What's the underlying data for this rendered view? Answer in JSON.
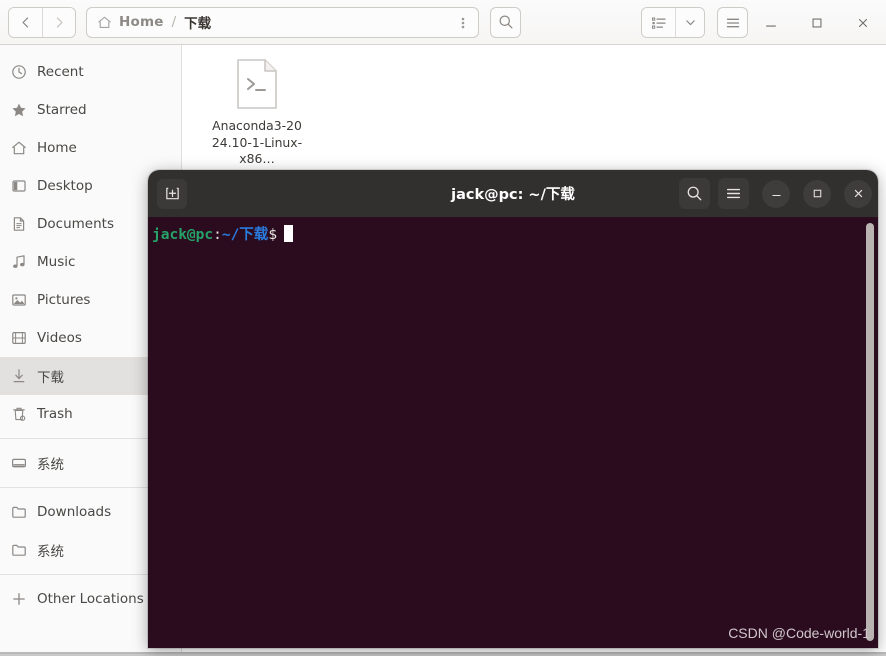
{
  "file_manager": {
    "header": {
      "back_label": "Back",
      "forward_label": "Forward",
      "breadcrumb_home": "Home",
      "breadcrumb_sep": "/",
      "breadcrumb_current": "下载",
      "path_menu_label": "⋮",
      "search_label": "Search",
      "view_list_label": "List view",
      "view_chevron_label": "View options",
      "menu_label": "Main menu",
      "minimize_label": "Minimize",
      "maximize_label": "Maximize",
      "close_label": "Close"
    },
    "sidebar": {
      "items": [
        {
          "label": "Recent",
          "icon": "clock-icon",
          "selected": false,
          "sep_after": false
        },
        {
          "label": "Starred",
          "icon": "star-icon",
          "selected": false,
          "sep_after": false
        },
        {
          "label": "Home",
          "icon": "home-icon",
          "selected": false,
          "sep_after": false
        },
        {
          "label": "Desktop",
          "icon": "desktop-icon",
          "selected": false,
          "sep_after": false
        },
        {
          "label": "Documents",
          "icon": "document-icon",
          "selected": false,
          "sep_after": false
        },
        {
          "label": "Music",
          "icon": "music-icon",
          "selected": false,
          "sep_after": false
        },
        {
          "label": "Pictures",
          "icon": "picture-icon",
          "selected": false,
          "sep_after": false
        },
        {
          "label": "Videos",
          "icon": "video-icon",
          "selected": false,
          "sep_after": false
        },
        {
          "label": "下载",
          "icon": "download-icon",
          "selected": true,
          "sep_after": false
        },
        {
          "label": "Trash",
          "icon": "trash-icon",
          "selected": false,
          "sep_after": true
        },
        {
          "label": "系统",
          "icon": "drive-icon",
          "selected": false,
          "sep_after": true
        },
        {
          "label": "Downloads",
          "icon": "folder-icon",
          "selected": false,
          "sep_after": false
        },
        {
          "label": "系统",
          "icon": "folder-icon",
          "selected": false,
          "sep_after": true
        },
        {
          "label": "Other Locations",
          "icon": "plus-icon",
          "selected": false,
          "sep_after": false
        }
      ]
    },
    "content": {
      "files": [
        {
          "name": "Anaconda3-2024.10-1-Linux-x86…",
          "icon": "script-file-icon"
        }
      ]
    }
  },
  "terminal": {
    "new_tab_label": "New tab",
    "title": "jack@pc: ~/下载",
    "search_label": "Search",
    "menu_label": "Menu",
    "minimize_label": "Minimize",
    "maximize_label": "Maximize",
    "close_label": "Close",
    "prompt": {
      "user_host": "jack@pc",
      "colon": ":",
      "path": "~/下载",
      "sigil": "$"
    },
    "watermark": "CSDN @Code-world-1",
    "colors": {
      "background": "#2b0b1e",
      "header": "#322f2f",
      "user_host": "#26a269",
      "path": "#2a7bde",
      "text": "#e8e6e3"
    }
  }
}
